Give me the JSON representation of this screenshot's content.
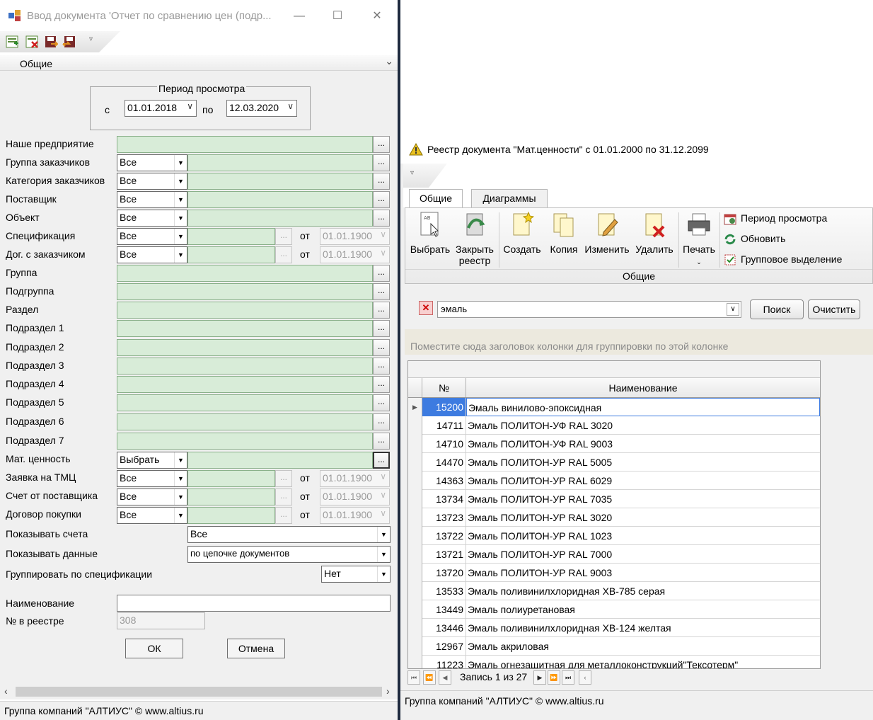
{
  "left_window": {
    "title": "Ввод документа 'Отчет по сравнению цен (подр...",
    "section_label": "Общие",
    "period": {
      "title": "Период просмотра",
      "from_label": "с",
      "from_value": "01.01.2018",
      "to_label": "по",
      "to_value": "12.03.2020"
    },
    "fields": {
      "our_company": "Наше предприятие",
      "customer_group": "Группа заказчиков",
      "customer_category": "Категория заказчиков",
      "supplier": "Поставщик",
      "object": "Объект",
      "specification": "Спецификация",
      "customer_contract": "Дог. с заказчиком",
      "group": "Группа",
      "subgroup": "Подгруппа",
      "section": "Раздел",
      "subsection_1": "Подраздел 1",
      "subsection_2": "Подраздел 2",
      "subsection_3": "Подраздел 3",
      "subsection_4": "Подраздел 4",
      "subsection_5": "Подраздел 5",
      "subsection_6": "Подраздел 6",
      "subsection_7": "Подраздел 7",
      "material": "Мат. ценность",
      "tmc_request": "Заявка на ТМЦ",
      "supplier_invoice": "Счет от поставщика",
      "purchase_contract": "Договор покупки",
      "show_invoices": "Показывать счета",
      "show_data": "Показывать данные",
      "group_by_spec": "Группировать по спецификации",
      "name": "Наименование",
      "registry_no": "№ в реестре"
    },
    "values": {
      "all": "Все",
      "choose": "Выбрать",
      "ot": "от",
      "date_default": "01.01.1900",
      "show_invoices": "Все",
      "show_data": "по цепочке документов",
      "group_by_spec": "Нет",
      "registry_no": "308",
      "dots": "..."
    },
    "buttons": {
      "ok": "ОК",
      "cancel": "Отмена"
    },
    "status": "Группа компаний \"АЛТИУС\" © www.altius.ru"
  },
  "right_window": {
    "title": "Реестр документа \"Мат.ценности\" с 01.01.2000 по 31.12.2099",
    "tabs": [
      "Общие",
      "Диаграммы"
    ],
    "ribbon": {
      "select": "Выбрать",
      "close_registry_1": "Закрыть",
      "close_registry_2": "реестр",
      "create": "Создать",
      "copy": "Копия",
      "edit": "Изменить",
      "delete": "Удалить",
      "print": "Печать",
      "period": "Период просмотра",
      "refresh": "Обновить",
      "group_select": "Групповое выделение",
      "group_label": "Общие"
    },
    "search": {
      "value": "эмаль",
      "find": "Поиск",
      "clear": "Очистить"
    },
    "group_hint": "Поместите сюда заголовок колонки для группировки по этой колонке",
    "grid": {
      "headers": {
        "no": "№",
        "name": "Наименование"
      },
      "rows": [
        {
          "no": "15200",
          "name": "Эмаль винилово-эпоксидная"
        },
        {
          "no": "14711",
          "name": "Эмаль ПОЛИТОН-УФ RAL 3020"
        },
        {
          "no": "14710",
          "name": "Эмаль ПОЛИТОН-УФ RAL 9003"
        },
        {
          "no": "14470",
          "name": "Эмаль ПОЛИТОН-УР RAL 5005"
        },
        {
          "no": "14363",
          "name": "Эмаль ПОЛИТОН-УР RAL 6029"
        },
        {
          "no": "13734",
          "name": "Эмаль ПОЛИТОН-УР RAL 7035"
        },
        {
          "no": "13723",
          "name": "Эмаль ПОЛИТОН-УР RAL 3020"
        },
        {
          "no": "13722",
          "name": "Эмаль ПОЛИТОН-УР RAL 1023"
        },
        {
          "no": "13721",
          "name": "Эмаль ПОЛИТОН-УР RAL 7000"
        },
        {
          "no": "13720",
          "name": "Эмаль ПОЛИТОН-УР RAL 9003"
        },
        {
          "no": "13533",
          "name": "Эмаль поливинилхлоридная ХВ-785 серая"
        },
        {
          "no": "13449",
          "name": "Эмаль полиуретановая"
        },
        {
          "no": "13446",
          "name": "Эмаль поливинилхлоридная ХВ-124 желтая"
        },
        {
          "no": "12967",
          "name": "Эмаль акриловая"
        },
        {
          "no": "11223",
          "name": "Эмаль огнезащитная для металлоконструкций\"Тексотерм\""
        }
      ]
    },
    "record_nav": "Запись 1 из 27",
    "status": "Группа компаний \"АЛТИУС\" © www.altius.ru"
  },
  "colors": {
    "field_green": "#d8ecd8",
    "selection_blue": "#3d7be0",
    "window_bg": "#f0f0f0"
  }
}
